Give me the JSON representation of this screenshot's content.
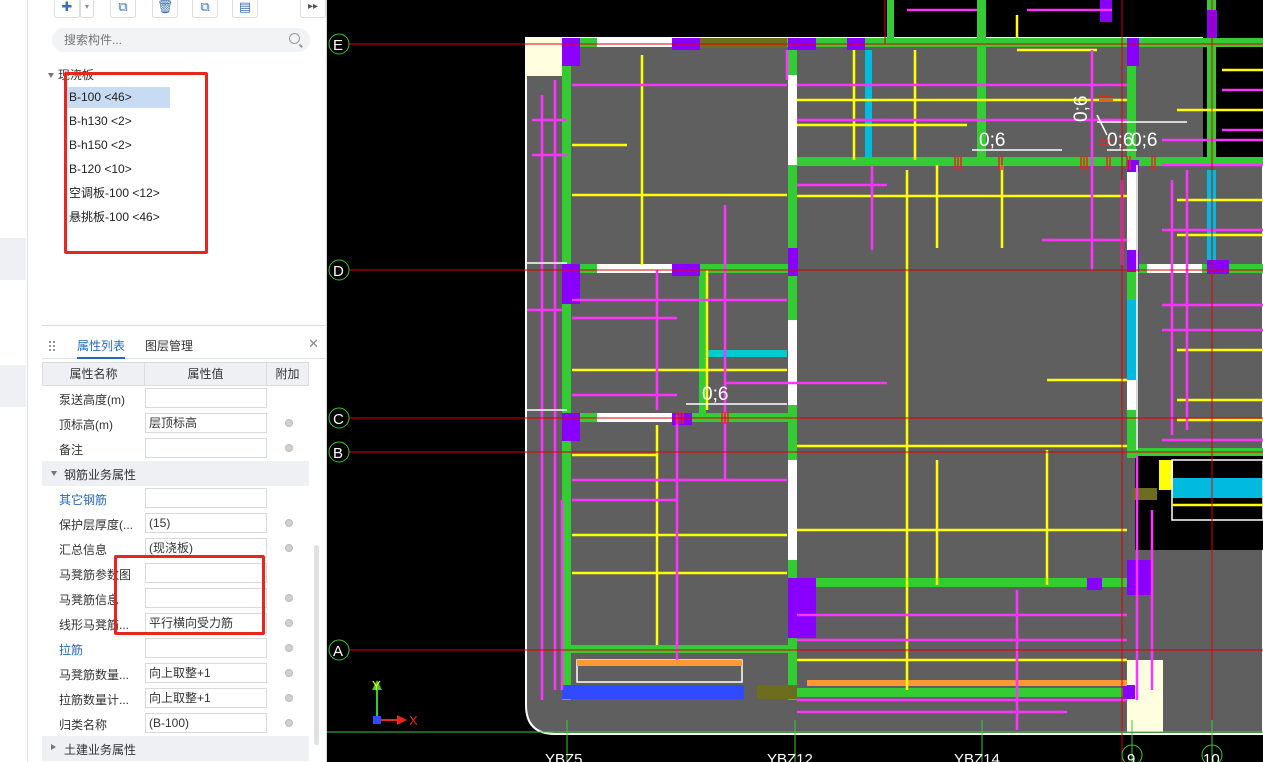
{
  "search": {
    "placeholder": "搜索构件..."
  },
  "tree": {
    "group": "现浇板",
    "items": [
      {
        "label": "B-100 <46>",
        "selected": true
      },
      {
        "label": "B-h130 <2>"
      },
      {
        "label": "B-h150 <2>"
      },
      {
        "label": "B-120 <10>"
      },
      {
        "label": "空调板-100 <12>"
      },
      {
        "label": "悬挑板-100 <46>"
      }
    ]
  },
  "prop_panel": {
    "tabs": [
      "属性列表",
      "图层管理"
    ],
    "headers": [
      "属性名称",
      "属性值",
      "附加"
    ],
    "rows": [
      {
        "name": "泵送高度(m)",
        "value": ""
      },
      {
        "name": "顶标高(m)",
        "value": "层顶标高"
      },
      {
        "name": "备注",
        "value": ""
      },
      {
        "name": "钢筋业务属性",
        "section": true
      },
      {
        "name": "其它钢筋",
        "value": "",
        "link": true
      },
      {
        "name": "保护层厚度(...",
        "value": "(15)"
      },
      {
        "name": "汇总信息",
        "value": "(现浇板)"
      },
      {
        "name": "马凳筋参数图",
        "value": ""
      },
      {
        "name": "马凳筋信息",
        "value": ""
      },
      {
        "name": "线形马凳筋...",
        "value": "平行横向受力筋"
      },
      {
        "name": "拉筋",
        "value": "",
        "link": true
      },
      {
        "name": "马凳筋数量...",
        "value": "向上取整+1"
      },
      {
        "name": "拉筋数量计...",
        "value": "向上取整+1"
      },
      {
        "name": "归类名称",
        "value": "(B-100)"
      },
      {
        "name": "土建业务属性",
        "section": true,
        "collapsed": true
      }
    ]
  },
  "drawing": {
    "axes_rows": [
      "E",
      "D",
      "C",
      "B",
      "A"
    ],
    "axes_cols": [
      "YBZ5",
      "YBZ12",
      "YBZ14",
      "9",
      "10"
    ],
    "dims": [
      "0;6",
      "0;6",
      "0;6",
      "0;6",
      "0;6"
    ],
    "ucs": {
      "y": "Y",
      "x": "X"
    }
  },
  "colors": {
    "accent": "#2468c4",
    "highlight_box": "#e8251f",
    "slab": "#5f5f5f",
    "beam": "#33cc33",
    "column": "#8a00ff",
    "rebar_yellow": "#ffff00",
    "rebar_magenta": "#ff33ff",
    "axis": "#e00000"
  },
  "icons": [
    "new-icon",
    "dropdown-icon",
    "copy-icon",
    "delete-icon",
    "copy-floor-icon",
    "import-icon",
    "more-icon",
    "search-icon",
    "close-icon",
    "collapse-icon"
  ]
}
